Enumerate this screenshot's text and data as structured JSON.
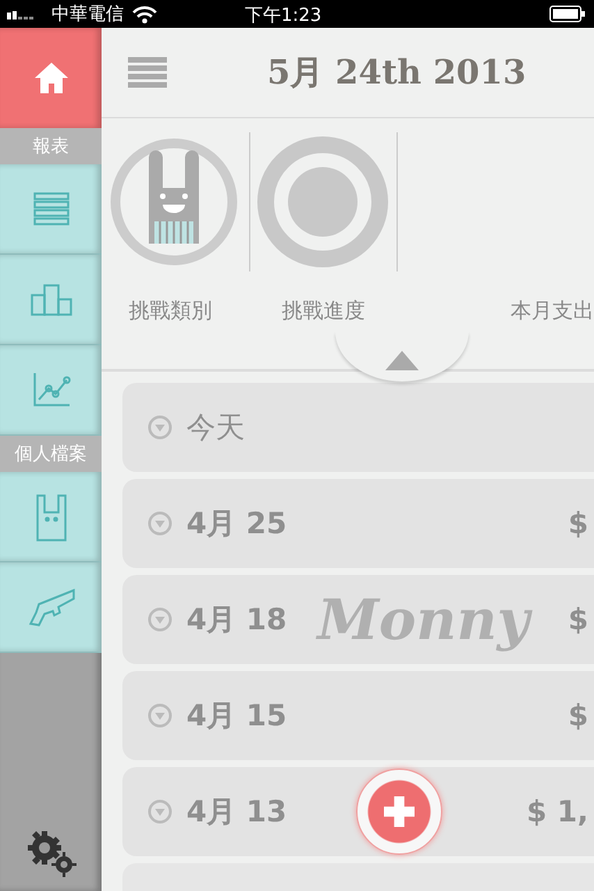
{
  "status_bar": {
    "carrier": "中華電信",
    "time": "下午1:23"
  },
  "sidebar": {
    "items": [
      {
        "kind": "icon",
        "selected": true
      },
      {
        "kind": "header",
        "label": "報表"
      },
      {
        "kind": "icon",
        "selected": false
      },
      {
        "kind": "icon",
        "selected": false
      },
      {
        "kind": "icon",
        "selected": false
      },
      {
        "kind": "header",
        "label": "個人檔案"
      },
      {
        "kind": "icon",
        "selected": false
      },
      {
        "kind": "icon",
        "selected": false
      }
    ]
  },
  "header": {
    "title": "5月 24th 2013"
  },
  "summary": {
    "items": [
      {
        "label": "挑戰類別"
      },
      {
        "label": "挑戰進度"
      },
      {
        "label": "本月支出"
      }
    ]
  },
  "days": [
    {
      "kind": "day",
      "label": "今天"
    },
    {
      "kind": "day",
      "label": "4月 25",
      "amount": "$"
    },
    {
      "kind": "day",
      "label": "4月 18",
      "amount": "$",
      "logo": "Monny"
    },
    {
      "kind": "day",
      "label": "4月 15",
      "amount": "$"
    },
    {
      "kind": "day",
      "label": "4月 13",
      "amount": "$ 1,"
    },
    {
      "kind": "blank"
    }
  ]
}
